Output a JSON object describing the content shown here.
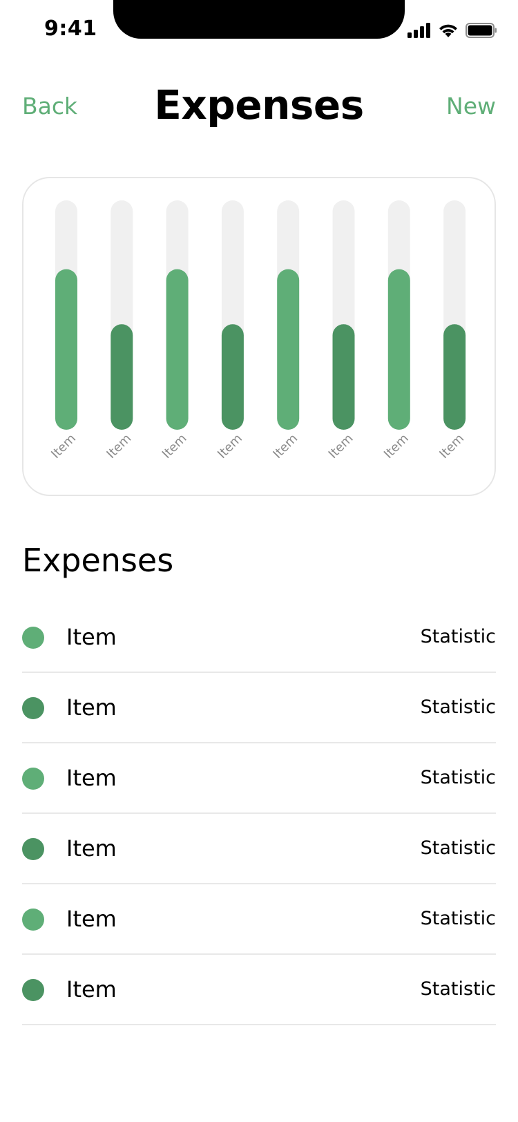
{
  "status_bar": {
    "time": "9:41",
    "icons": [
      "signal-icon",
      "wifi-icon",
      "battery-icon"
    ]
  },
  "nav": {
    "back_label": "Back",
    "title": "Expenses",
    "new_label": "New"
  },
  "colors": {
    "accent": "#5fae77",
    "accent_dark": "#4b9362",
    "track": "#f0f0f0",
    "divider": "#e8e8e8"
  },
  "chart_data": {
    "type": "bar",
    "categories": [
      "Item",
      "Item",
      "Item",
      "Item",
      "Item",
      "Item",
      "Item",
      "Item"
    ],
    "values": [
      70,
      46,
      70,
      46,
      70,
      46,
      70,
      46
    ],
    "ylim": [
      0,
      100
    ],
    "bar_colors": [
      "#5fae77",
      "#4b9362",
      "#5fae77",
      "#4b9362",
      "#5fae77",
      "#4b9362",
      "#5fae77",
      "#4b9362"
    ],
    "grid": false,
    "title": "",
    "xlabel": "",
    "ylabel": ""
  },
  "section": {
    "title": "Expenses"
  },
  "list": {
    "items": [
      {
        "label": "Item",
        "stat": "Statistic",
        "color": "#5fae77"
      },
      {
        "label": "Item",
        "stat": "Statistic",
        "color": "#4b9362"
      },
      {
        "label": "Item",
        "stat": "Statistic",
        "color": "#5fae77"
      },
      {
        "label": "Item",
        "stat": "Statistic",
        "color": "#4b9362"
      },
      {
        "label": "Item",
        "stat": "Statistic",
        "color": "#5fae77"
      },
      {
        "label": "Item",
        "stat": "Statistic",
        "color": "#4b9362"
      }
    ]
  }
}
